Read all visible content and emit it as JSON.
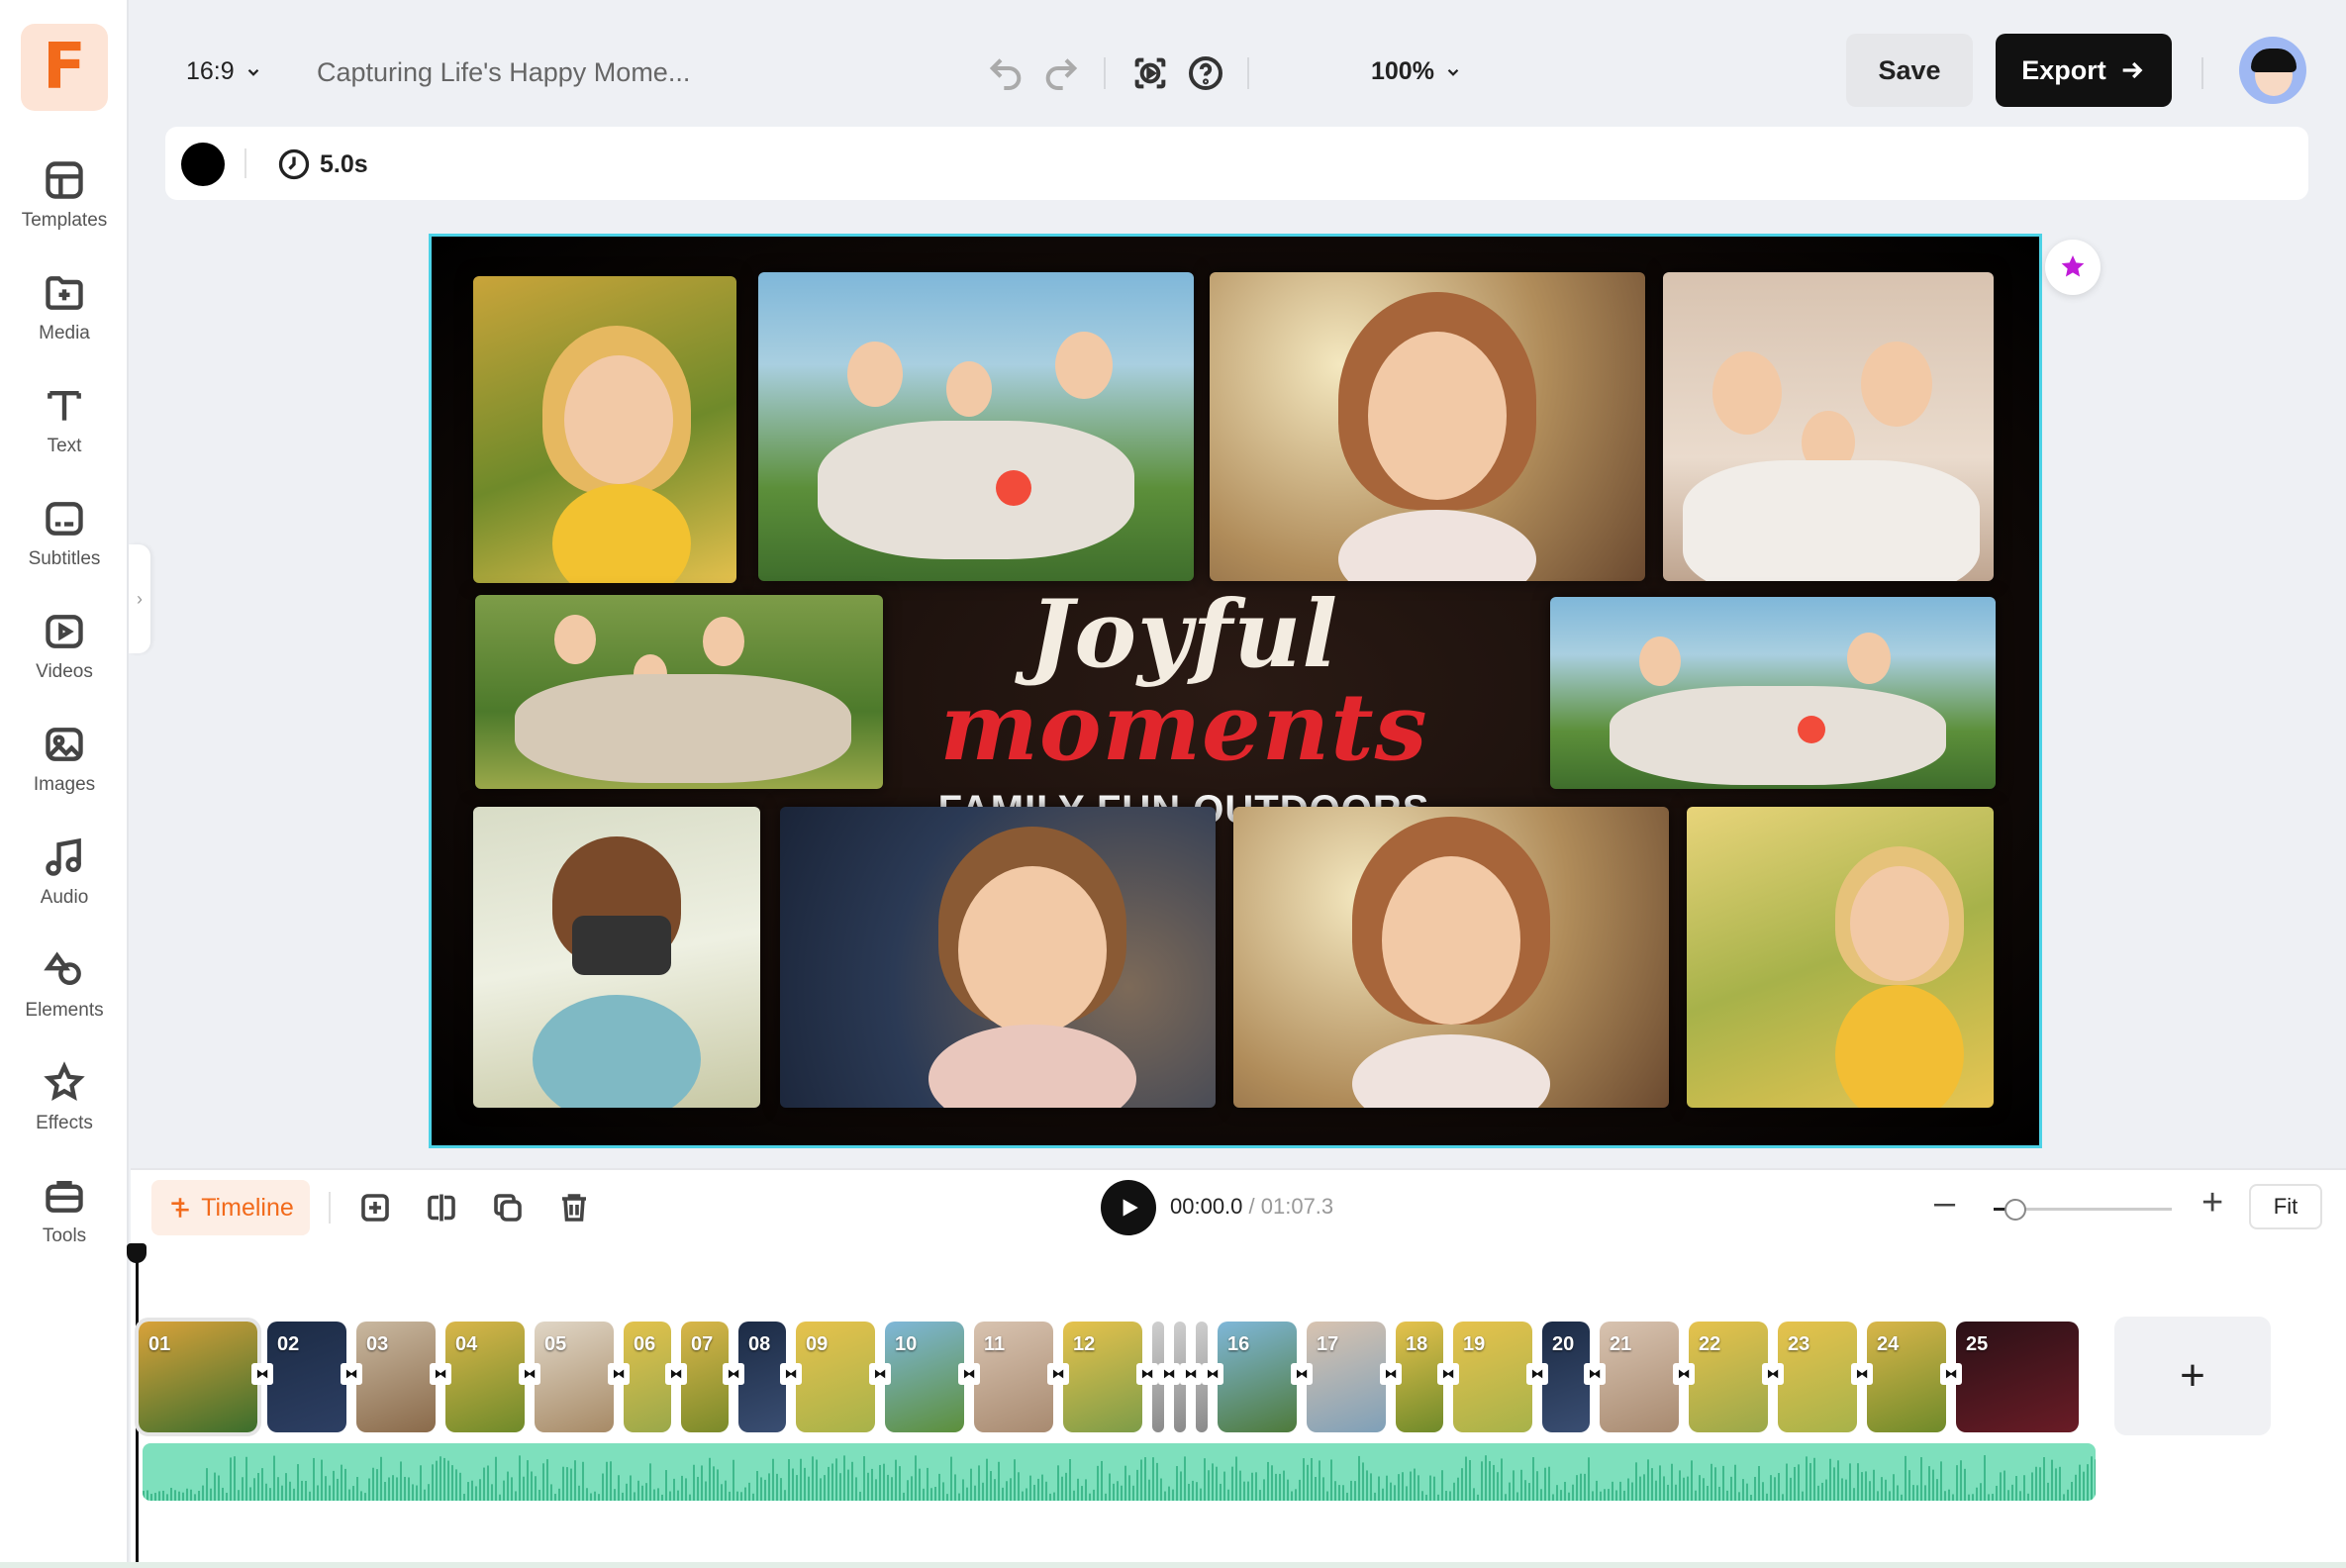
{
  "app": {
    "logo_letter": "F",
    "brand_color": "#f26a1b"
  },
  "sidebar": {
    "items": [
      {
        "label": "Templates",
        "icon": "templates-icon"
      },
      {
        "label": "Media",
        "icon": "media-icon"
      },
      {
        "label": "Text",
        "icon": "text-icon"
      },
      {
        "label": "Subtitles",
        "icon": "subtitles-icon"
      },
      {
        "label": "Videos",
        "icon": "videos-icon"
      },
      {
        "label": "Images",
        "icon": "images-icon"
      },
      {
        "label": "Audio",
        "icon": "audio-icon"
      },
      {
        "label": "Elements",
        "icon": "elements-icon"
      },
      {
        "label": "Effects",
        "icon": "effects-icon"
      },
      {
        "label": "Tools",
        "icon": "tools-icon"
      }
    ]
  },
  "topbar": {
    "aspect_ratio": "16:9",
    "project_title": "Capturing Life's Happy Mome...",
    "zoom": "100%",
    "save_label": "Save",
    "export_label": "Export"
  },
  "properties": {
    "color": "#000000",
    "duration": "5.0s"
  },
  "canvas": {
    "title_part1": "Joyful ",
    "title_part2": "moments",
    "subtitle": "FAMILY FUN OUTDOORS",
    "accent_red": "#e1262c",
    "selection_color": "#4cd2e6"
  },
  "timeline": {
    "tab_label": "Timeline",
    "current_time": "00:00.0",
    "separator": " / ",
    "total_time": "01:07.3",
    "fit_label": "Fit",
    "add_label": "+",
    "clips": [
      "01",
      "02",
      "03",
      "04",
      "05",
      "06",
      "07",
      "08",
      "09",
      "10",
      "11",
      "12",
      "",
      "",
      "",
      "16",
      "17",
      "18",
      "19",
      "20",
      "21",
      "22",
      "23",
      "24",
      "25"
    ],
    "zoom_level": 0.12
  }
}
